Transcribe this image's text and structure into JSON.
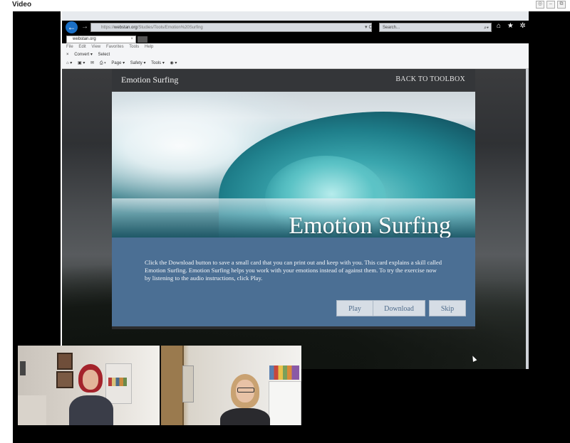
{
  "window": {
    "title": "Video",
    "controls": [
      "◎",
      "–",
      "⧉"
    ]
  },
  "browser": {
    "url_prefix": "https://",
    "url_domain": "webstan.org",
    "url_path": "/Studies/Tools/Emotion%20Surfing",
    "url_controls": "▾ C",
    "search_placeholder": "Search...",
    "search_icon": "⌕▾",
    "toolbar_icons": "⌂ ★ ✲",
    "tab_label": "webstan.org",
    "tab_close": "×",
    "menu": [
      "File",
      "Edit",
      "View",
      "Favorites",
      "Tools",
      "Help"
    ],
    "convert_items": [
      "×",
      "Convert ▾",
      "Select"
    ],
    "command_items": [
      "⌂ ▾",
      "▣ ▾",
      "✉",
      "⎙ ▾",
      "Page ▾",
      "Safety ▾",
      "Tools ▾",
      "◉ ▾"
    ]
  },
  "app": {
    "title": "Emotion Surfing",
    "back_link": "BACK TO TOOLBOX",
    "hero_title": "Emotion Surfing",
    "description": "Click the Download button to save a small card that you can print out and keep with you. This card explains a skill called Emotion Surfing. Emotion Surfing helps you work with your emotions instead of against them. To try the exercise now by listening to the audio instructions, click Play.",
    "buttons": {
      "play": "Play",
      "download": "Download",
      "skip": "Skip"
    }
  },
  "colors": {
    "panel": "#4b6f94",
    "button_bg": "#d6dde5",
    "button_text": "#4d6a8a",
    "header_bg": "#343639",
    "browser_back": "#1a6fc6"
  },
  "icons": {
    "back": "back-arrow-icon",
    "forward": "forward-arrow-icon",
    "home": "home-icon",
    "favorites": "star-icon",
    "settings": "gear-icon",
    "search": "search-icon"
  }
}
